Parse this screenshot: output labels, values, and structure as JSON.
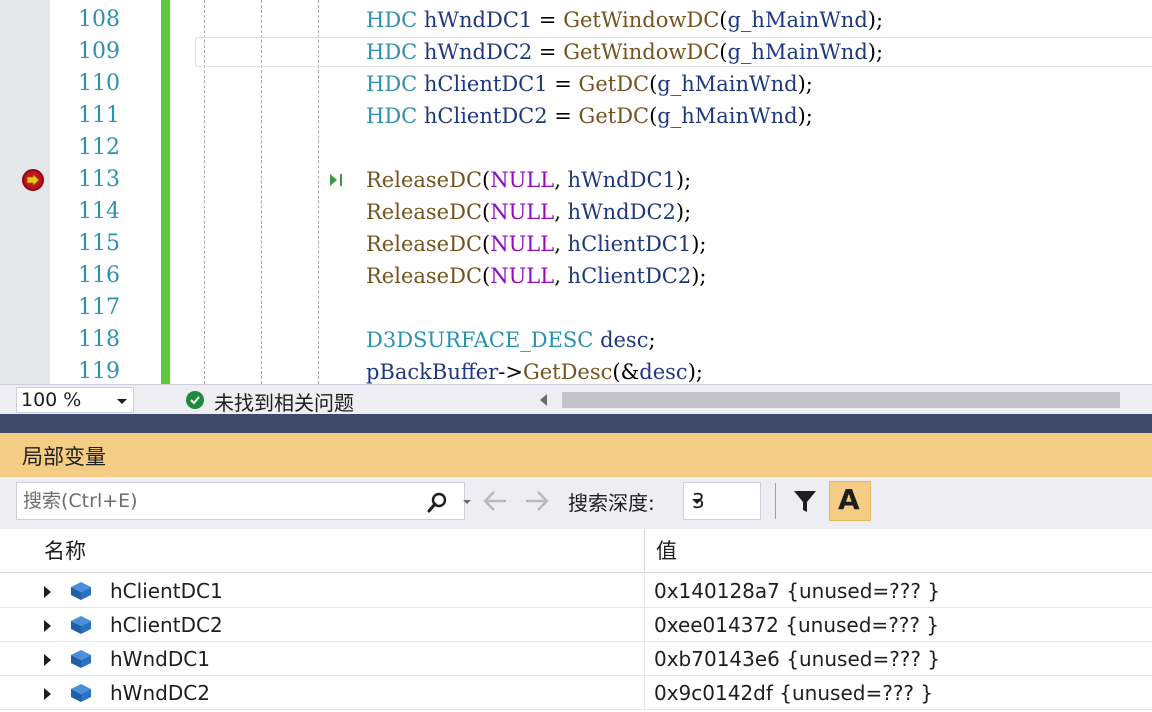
{
  "editor": {
    "lines": [
      {
        "num": "108",
        "tokens": [
          [
            "tk-type",
            "HDC"
          ],
          [
            "tk-op",
            " "
          ],
          [
            "tk-var",
            "hWndDC1"
          ],
          [
            "tk-op",
            " = "
          ],
          [
            "tk-fn",
            "GetWindowDC"
          ],
          [
            "tk-op",
            "("
          ],
          [
            "tk-var",
            "g_hMainWnd"
          ],
          [
            "tk-op",
            ");"
          ]
        ]
      },
      {
        "num": "109",
        "tokens": [
          [
            "tk-type",
            "HDC"
          ],
          [
            "tk-op",
            " "
          ],
          [
            "tk-var",
            "hWndDC2"
          ],
          [
            "tk-op",
            " = "
          ],
          [
            "tk-fn",
            "GetWindowDC"
          ],
          [
            "tk-op",
            "("
          ],
          [
            "tk-var",
            "g_hMainWnd"
          ],
          [
            "tk-op",
            ");"
          ]
        ]
      },
      {
        "num": "110",
        "tokens": [
          [
            "tk-type",
            "HDC"
          ],
          [
            "tk-op",
            " "
          ],
          [
            "tk-var",
            "hClientDC1"
          ],
          [
            "tk-op",
            " = "
          ],
          [
            "tk-fn",
            "GetDC"
          ],
          [
            "tk-op",
            "("
          ],
          [
            "tk-var",
            "g_hMainWnd"
          ],
          [
            "tk-op",
            ");"
          ]
        ]
      },
      {
        "num": "111",
        "tokens": [
          [
            "tk-type",
            "HDC"
          ],
          [
            "tk-op",
            " "
          ],
          [
            "tk-var",
            "hClientDC2"
          ],
          [
            "tk-op",
            " = "
          ],
          [
            "tk-fn",
            "GetDC"
          ],
          [
            "tk-op",
            "("
          ],
          [
            "tk-var",
            "g_hMainWnd"
          ],
          [
            "tk-op",
            ");"
          ]
        ]
      },
      {
        "num": "112",
        "tokens": []
      },
      {
        "num": "113",
        "tokens": [
          [
            "tk-fn",
            "ReleaseDC"
          ],
          [
            "tk-op",
            "("
          ],
          [
            "tk-macro",
            "NULL"
          ],
          [
            "tk-op",
            ", "
          ],
          [
            "tk-var",
            "hWndDC1"
          ],
          [
            "tk-op",
            ");"
          ]
        ]
      },
      {
        "num": "114",
        "tokens": [
          [
            "tk-fn",
            "ReleaseDC"
          ],
          [
            "tk-op",
            "("
          ],
          [
            "tk-macro",
            "NULL"
          ],
          [
            "tk-op",
            ", "
          ],
          [
            "tk-var",
            "hWndDC2"
          ],
          [
            "tk-op",
            ");"
          ]
        ]
      },
      {
        "num": "115",
        "tokens": [
          [
            "tk-fn",
            "ReleaseDC"
          ],
          [
            "tk-op",
            "("
          ],
          [
            "tk-macro",
            "NULL"
          ],
          [
            "tk-op",
            ", "
          ],
          [
            "tk-var",
            "hClientDC1"
          ],
          [
            "tk-op",
            ");"
          ]
        ]
      },
      {
        "num": "116",
        "tokens": [
          [
            "tk-fn",
            "ReleaseDC"
          ],
          [
            "tk-op",
            "("
          ],
          [
            "tk-macro",
            "NULL"
          ],
          [
            "tk-op",
            ", "
          ],
          [
            "tk-var",
            "hClientDC2"
          ],
          [
            "tk-op",
            ");"
          ]
        ]
      },
      {
        "num": "117",
        "tokens": []
      },
      {
        "num": "118",
        "tokens": [
          [
            "tk-type",
            "D3DSURFACE_DESC"
          ],
          [
            "tk-op",
            " "
          ],
          [
            "tk-var",
            "desc"
          ],
          [
            "tk-op",
            ";"
          ]
        ]
      },
      {
        "num": "119",
        "tokens": [
          [
            "tk-var",
            "pBackBuffer"
          ],
          [
            "tk-op",
            "->"
          ],
          [
            "tk-fn",
            "GetDesc"
          ],
          [
            "tk-op",
            "(&"
          ],
          [
            "tk-var",
            "desc"
          ],
          [
            "tk-op",
            ");"
          ]
        ]
      }
    ],
    "breakpoint_line": "113",
    "current_line": "113",
    "highlighted_line": "109"
  },
  "status": {
    "zoom": "100 %",
    "issues": "未找到相关问题"
  },
  "locals": {
    "title": "局部变量",
    "search_placeholder": "搜索(Ctrl+E)",
    "depth_label": "搜索深度:",
    "depth_value": "3",
    "case_button": "A",
    "columns": {
      "name": "名称",
      "value": "值"
    },
    "rows": [
      {
        "name": "hClientDC1",
        "value": "0x140128a7 {unused=??? }"
      },
      {
        "name": "hClientDC2",
        "value": "0xee014372 {unused=??? }"
      },
      {
        "name": "hWndDC1",
        "value": "0xb70143e6 {unused=??? }"
      },
      {
        "name": "hWndDC2",
        "value": "0x9c0142df {unused=??? }"
      }
    ]
  },
  "colors": {
    "title_accent": "#f5cc84",
    "change_bar": "#5ec73b",
    "splitter": "#3f4a6b"
  }
}
